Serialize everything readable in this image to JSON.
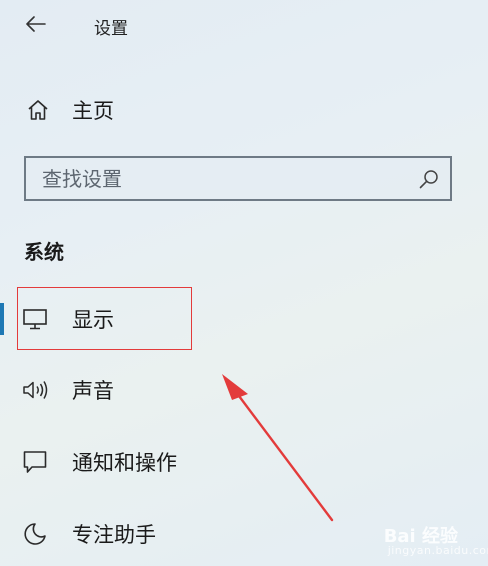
{
  "header": {
    "title": "设置"
  },
  "nav": {
    "home_label": "主页"
  },
  "search": {
    "placeholder": "查找设置"
  },
  "section": {
    "title": "系统"
  },
  "items": [
    {
      "label": "显示",
      "icon": "monitor-icon",
      "active": true
    },
    {
      "label": "声音",
      "icon": "speaker-icon"
    },
    {
      "label": "通知和操作",
      "icon": "notification-icon"
    },
    {
      "label": "专注助手",
      "icon": "moon-icon"
    }
  ],
  "annotation": {
    "color": "#e33b3b"
  },
  "watermark": {
    "brand": "Bai 经验",
    "url": "jingyan.baidu.com"
  },
  "colors": {
    "accent": "#1e78b4"
  }
}
